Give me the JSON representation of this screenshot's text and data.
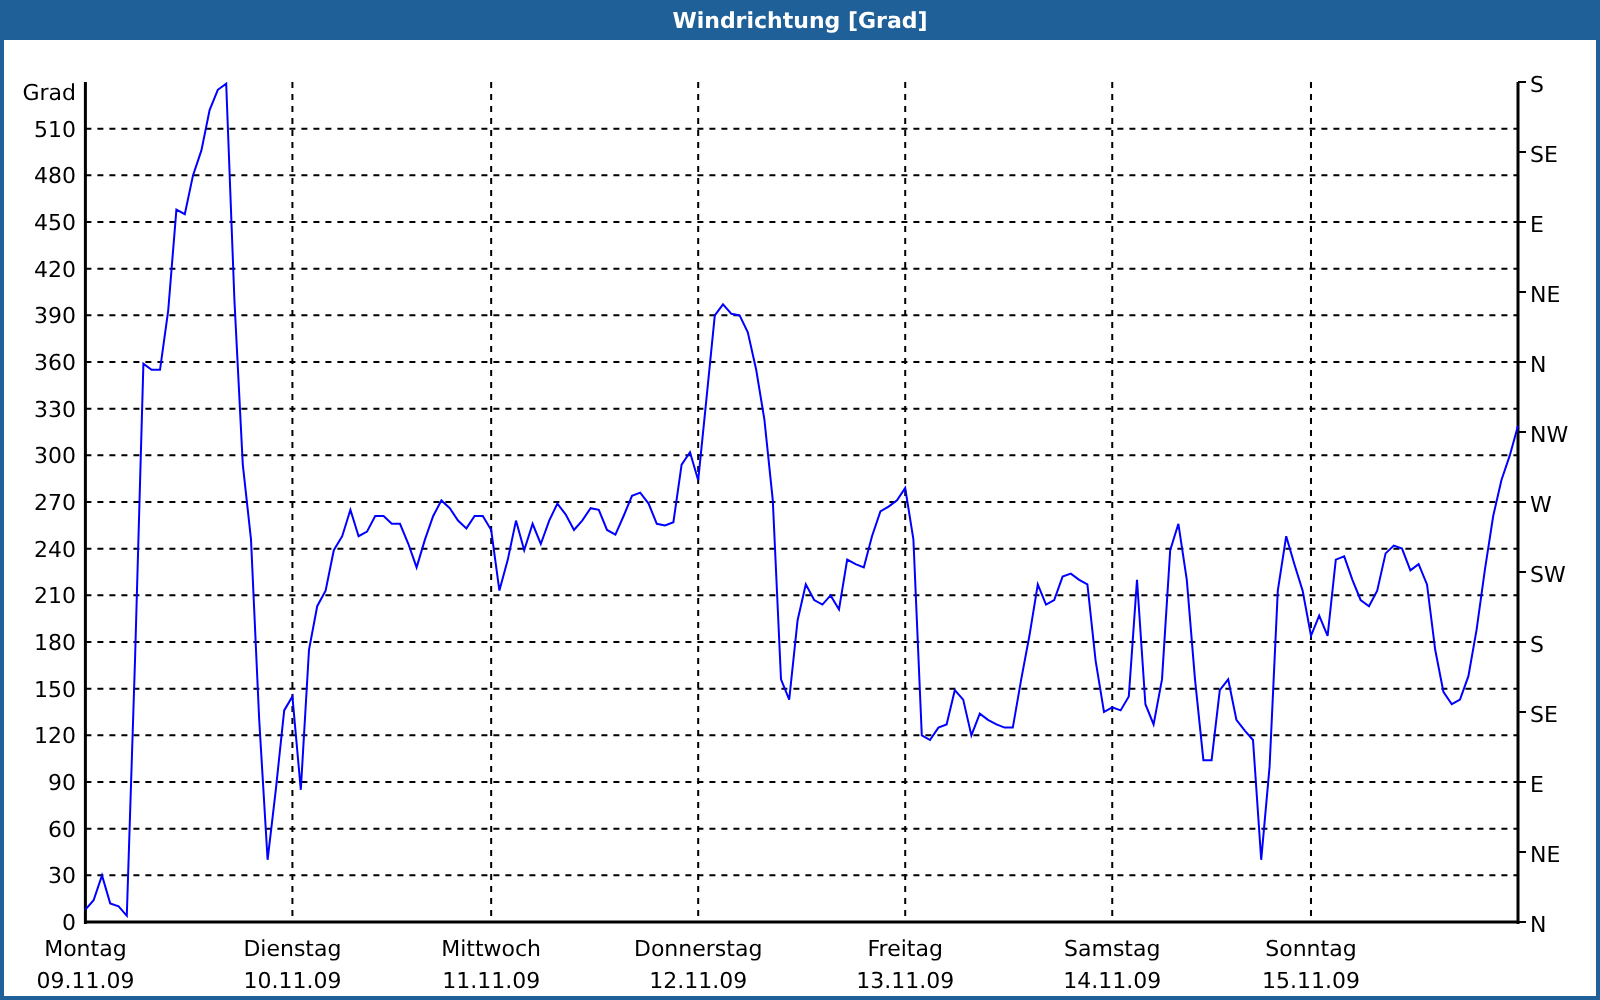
{
  "window": {
    "title": "Windrichtung [Grad]"
  },
  "chart": {
    "right_axis": {
      "labels": [
        "S",
        "SE",
        "E",
        "NE",
        "N",
        "NW",
        "W",
        "SW",
        "S",
        "SE",
        "E",
        "NE",
        "N"
      ]
    },
    "chart_data": {
      "type": "line",
      "grid": true,
      "ylabel": "Grad",
      "ylim": [
        0,
        540
      ],
      "yticks": [
        0,
        30,
        60,
        90,
        120,
        150,
        180,
        210,
        240,
        270,
        300,
        330,
        360,
        390,
        420,
        450,
        480,
        510
      ],
      "categories": [
        "Montag 09.11.09",
        null,
        null,
        null,
        null,
        null,
        null,
        null,
        null,
        null,
        null,
        null,
        null,
        null,
        null,
        null,
        null,
        null,
        null,
        null,
        null,
        null,
        null,
        null,
        null,
        "Dienstag 10.11.09",
        null,
        null,
        null,
        null,
        null,
        null,
        null,
        null,
        null,
        null,
        null,
        null,
        null,
        null,
        null,
        null,
        null,
        null,
        null,
        null,
        null,
        null,
        null,
        "Mittwoch 11.11.09",
        null,
        null,
        null,
        null,
        null,
        null,
        null,
        null,
        null,
        null,
        null,
        null,
        null,
        null,
        null,
        null,
        null,
        null,
        null,
        null,
        null,
        null,
        null,
        null,
        "Donnerstag 12.11.09",
        null,
        null,
        null,
        null,
        null,
        null,
        null,
        null,
        null,
        null,
        null,
        null,
        null,
        null,
        null,
        null,
        null,
        null,
        null,
        null,
        null,
        null,
        null,
        null,
        "Freitag 13.11.09",
        null,
        null,
        null,
        null,
        null,
        null,
        null,
        null,
        null,
        null,
        null,
        null,
        null,
        null,
        null,
        null,
        null,
        null,
        null,
        null,
        null,
        null,
        null,
        null,
        "Samstag 14.11.09",
        null,
        null,
        null,
        null,
        null,
        null,
        null,
        null,
        null,
        null,
        null,
        null,
        null,
        null,
        null,
        null,
        null,
        null,
        null,
        null,
        null,
        null,
        null,
        "Sonntag 15.11.09",
        null,
        null,
        null,
        null,
        null,
        null,
        null,
        null,
        null,
        null,
        null,
        null,
        null,
        null,
        null,
        null,
        null,
        null,
        null,
        null,
        null,
        null,
        null,
        null,
        null
      ],
      "series": [
        {
          "color": "#0000ff",
          "values": [
            8,
            14,
            30,
            12,
            10,
            4,
            168,
            359,
            355,
            355,
            393,
            458,
            455,
            480,
            496,
            522,
            535,
            539,
            400,
            294,
            246,
            130,
            40,
            85,
            136,
            145,
            85,
            175,
            203,
            213,
            239,
            248,
            265,
            248,
            251,
            261,
            261,
            256,
            256,
            243,
            228,
            246,
            261,
            271,
            266,
            258,
            253,
            261,
            261,
            252,
            213,
            233,
            258,
            239,
            256,
            243,
            258,
            269,
            262,
            252,
            258,
            266,
            265,
            252,
            249,
            261,
            274,
            276,
            269,
            256,
            255,
            257,
            294,
            302,
            284,
            336,
            390,
            397,
            391,
            390,
            379,
            355,
            323,
            271,
            156,
            143,
            194,
            217,
            207,
            204,
            210,
            201,
            233,
            230,
            228,
            248,
            264,
            267,
            271,
            279,
            246,
            120,
            117,
            125,
            127,
            149,
            143,
            120,
            134,
            130,
            127,
            125,
            125,
            156,
            184,
            217,
            204,
            207,
            222,
            224,
            220,
            217,
            168,
            135,
            138,
            136,
            145,
            220,
            140,
            127,
            156,
            239,
            256,
            220,
            156,
            104,
            104,
            149,
            156,
            130,
            123,
            117,
            40,
            100,
            213,
            248,
            230,
            213,
            184,
            197,
            184,
            233,
            235,
            220,
            207,
            203,
            213,
            237,
            242,
            240,
            226,
            230,
            217,
            175,
            148,
            140,
            143,
            158,
            188,
            226,
            261,
            284,
            300,
            319
          ]
        }
      ]
    }
  }
}
